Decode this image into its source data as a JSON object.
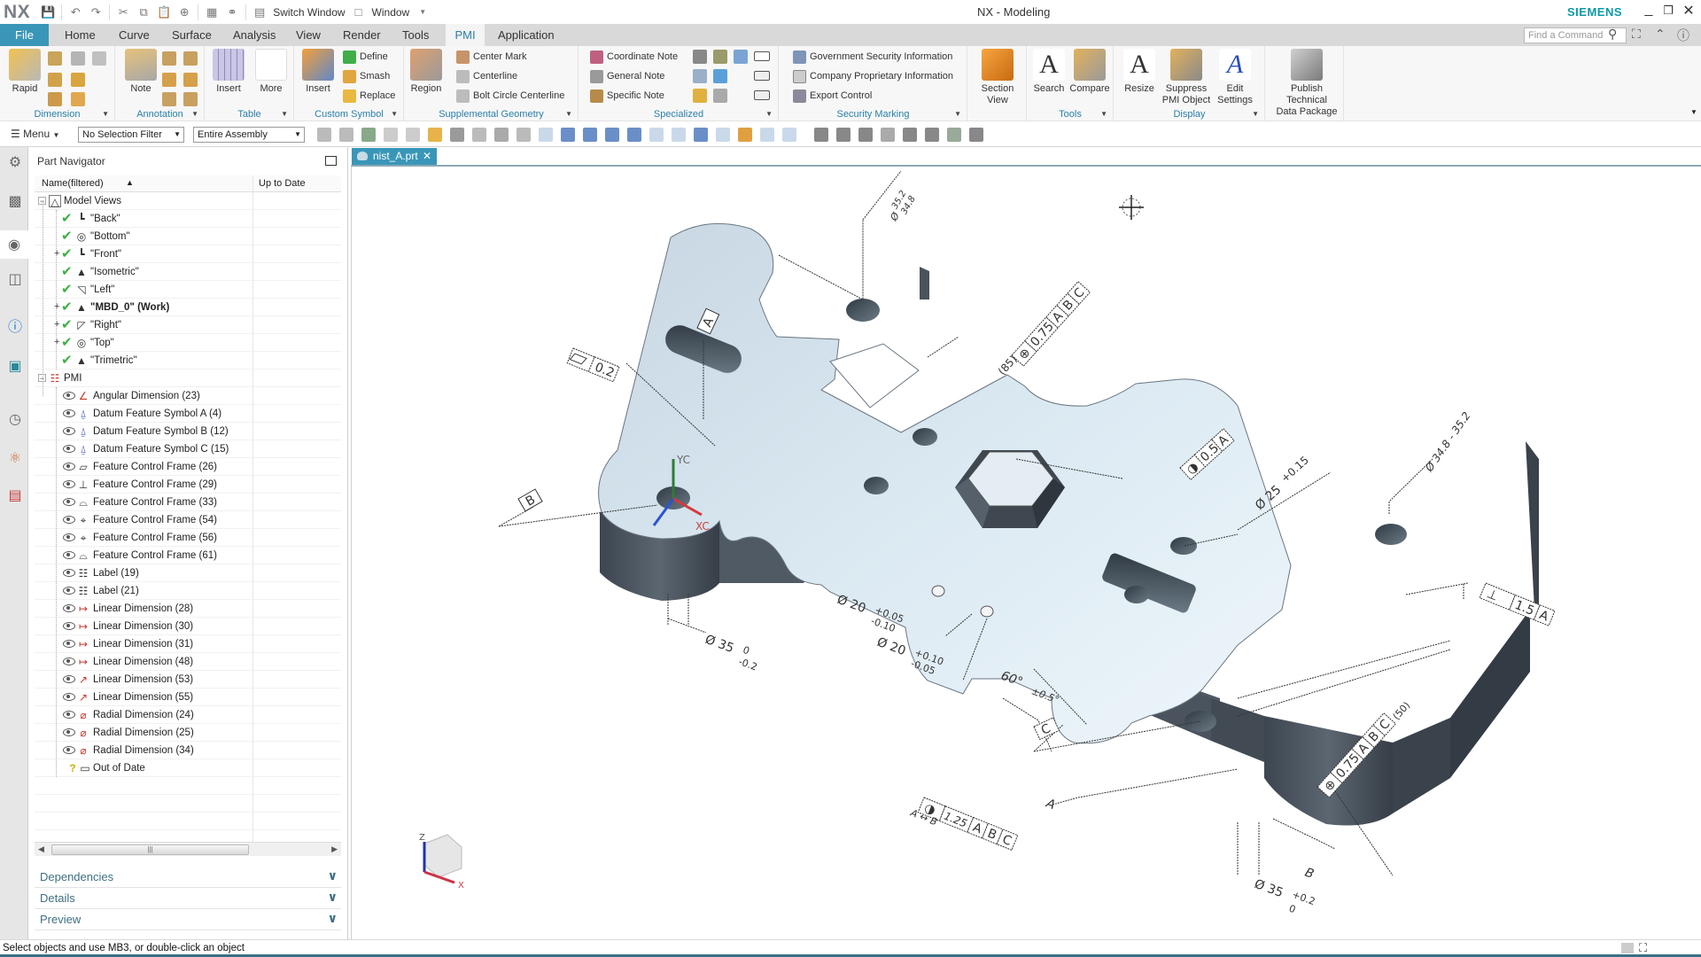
{
  "app": {
    "logo": "NX",
    "title": "NX - Modeling",
    "brand": "SIEMENS",
    "quick_access": {
      "switch_window": "Switch Window",
      "window": "Window"
    },
    "window_controls": {
      "minimize": "_",
      "restore": "❐",
      "close": "✕"
    }
  },
  "ribbon_tabs": [
    {
      "label": "File"
    },
    {
      "label": "Home"
    },
    {
      "label": "Curve"
    },
    {
      "label": "Surface"
    },
    {
      "label": "Analysis"
    },
    {
      "label": "View"
    },
    {
      "label": "Render"
    },
    {
      "label": "Tools"
    },
    {
      "label": "PMI",
      "active": true
    },
    {
      "label": "Application"
    }
  ],
  "find_command": {
    "placeholder": "Find a Command"
  },
  "ribbon_groups": {
    "dimension": {
      "label": "Dimension",
      "rapid": "Rapid"
    },
    "annotation": {
      "label": "Annotation",
      "note": "Note"
    },
    "table": {
      "label": "Table",
      "insert": "Insert",
      "more": "More"
    },
    "custom_symbol": {
      "label": "Custom Symbol",
      "insert": "Insert",
      "define": "Define",
      "smash": "Smash",
      "replace": "Replace"
    },
    "supplemental_geometry": {
      "label": "Supplemental Geometry",
      "region": "Region",
      "center_mark": "Center Mark",
      "centerline": "Centerline",
      "bolt_circle_centerline": "Bolt Circle Centerline"
    },
    "specialized": {
      "label": "Specialized",
      "coordinate_note": "Coordinate Note",
      "general_note": "General Note",
      "specific_note": "Specific Note"
    },
    "security_marking": {
      "label": "Security Marking",
      "government": "Government Security Information",
      "company": "Company Proprietary Information",
      "export": "Export Control"
    },
    "section_view": {
      "line1": "Section",
      "line2": "View"
    },
    "tools": {
      "label": "Tools",
      "search": "Search",
      "compare": "Compare"
    },
    "display": {
      "label": "Display",
      "resize": "Resize",
      "suppress1": "Suppress",
      "suppress2": "PMI Object",
      "edit1": "Edit",
      "edit2": "Settings"
    },
    "publish": {
      "line1": "Publish Technical",
      "line2": "Data Package"
    }
  },
  "selection_bar": {
    "menu": "Menu",
    "filter": "No Selection Filter",
    "scope": "Entire Assembly"
  },
  "navigator": {
    "title": "Part Navigator",
    "col_name": "Name(filtered)",
    "col_status": "Up to Date",
    "model_views_label": "Model Views",
    "model_views": [
      {
        "label": "\"Back\"",
        "expandable": false
      },
      {
        "label": "\"Bottom\"",
        "expandable": false
      },
      {
        "label": "\"Front\"",
        "expandable": true
      },
      {
        "label": "\"Isometric\"",
        "expandable": false
      },
      {
        "label": "\"Left\"",
        "expandable": false
      },
      {
        "label": "\"MBD_0\" (Work)",
        "expandable": true,
        "bold": true
      },
      {
        "label": "\"Right\"",
        "expandable": true
      },
      {
        "label": "\"Top\"",
        "expandable": true
      },
      {
        "label": "\"Trimetric\"",
        "expandable": false
      }
    ],
    "pmi_label": "PMI",
    "pmi_items": [
      {
        "label": "Angular Dimension (23)",
        "icon": "angular-dimension-icon"
      },
      {
        "label": "Datum Feature Symbol A (4)",
        "icon": "datum-feature-icon"
      },
      {
        "label": "Datum Feature Symbol B (12)",
        "icon": "datum-feature-icon"
      },
      {
        "label": "Datum Feature Symbol C (15)",
        "icon": "datum-feature-icon"
      },
      {
        "label": "Feature Control Frame (26)",
        "icon": "flatness-icon"
      },
      {
        "label": "Feature Control Frame (29)",
        "icon": "perpendicularity-icon"
      },
      {
        "label": "Feature Control Frame (33)",
        "icon": "surface-profile-icon"
      },
      {
        "label": "Feature Control Frame (54)",
        "icon": "position-icon"
      },
      {
        "label": "Feature Control Frame (56)",
        "icon": "position-icon"
      },
      {
        "label": "Feature Control Frame (61)",
        "icon": "surface-profile-icon"
      },
      {
        "label": "Label (19)",
        "icon": "label-icon"
      },
      {
        "label": "Label (21)",
        "icon": "label-icon"
      },
      {
        "label": "Linear Dimension (28)",
        "icon": "linear-dimension-icon"
      },
      {
        "label": "Linear Dimension (30)",
        "icon": "linear-dimension-icon"
      },
      {
        "label": "Linear Dimension (31)",
        "icon": "linear-dimension-icon"
      },
      {
        "label": "Linear Dimension (48)",
        "icon": "linear-dimension-icon"
      },
      {
        "label": "Linear Dimension (53)",
        "icon": "linear-dimension-angled-icon"
      },
      {
        "label": "Linear Dimension (55)",
        "icon": "linear-dimension-angled-icon"
      },
      {
        "label": "Radial Dimension (24)",
        "icon": "radial-dimension-icon"
      },
      {
        "label": "Radial Dimension (25)",
        "icon": "radial-dimension-icon"
      },
      {
        "label": "Radial Dimension (34)",
        "icon": "radial-dimension-alt-icon"
      }
    ],
    "out_of_date": "Out of Date",
    "panels": [
      {
        "label": "Dependencies"
      },
      {
        "label": "Details"
      },
      {
        "label": "Preview"
      }
    ]
  },
  "document_tab": {
    "label": "nist_A.prt"
  },
  "viewport": {
    "wcs": {
      "x": "XC",
      "y": "YC"
    },
    "triad": {
      "x": "X",
      "z": "Z"
    },
    "annotations": {
      "top_hole_dia_upper": "35.2",
      "top_hole_dia_lower": "34.8",
      "flatness_tol": "0.2",
      "datum_a": "A",
      "datum_b": "B",
      "datum_c": "C",
      "pos_tol_top": "0.75",
      "basic_dim": "(85)",
      "profile_tol": "0.5",
      "dia25": "Ø 25",
      "dia25_tol": "+0.15",
      "dia_range_right": "Ø 34.8 - 35.2",
      "perp_tol": "1.5",
      "dia20_a": "Ø 20",
      "dia20_a_upper": "+0.05",
      "dia20_a_lower": "-0.10",
      "dia20_b": "Ø 20",
      "dia20_b_upper": "+0.10",
      "dia20_b_lower": "-0.05",
      "angle": "60°",
      "angle_tol": "±0.5°",
      "dia35_left": "Ø 35",
      "dia35_left_upper": "0",
      "dia35_left_lower": "-0.2",
      "dia35_right": "Ø 35",
      "dia35_right_upper": "+0.2",
      "dia35_right_lower": "0",
      "profile_tol_bottom": "1.25",
      "between": "A ↔ B",
      "pos_tol_bottom": "0.75",
      "dim_50": "(50)"
    }
  },
  "status": {
    "message": "Select objects and use MB3, or double-click an object"
  }
}
